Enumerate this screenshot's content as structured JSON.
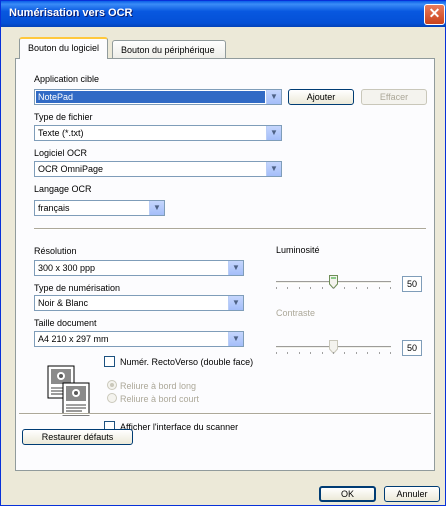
{
  "window": {
    "title": "Numérisation vers OCR",
    "close_glyph": "✕"
  },
  "tabs": [
    {
      "label": "Bouton du logiciel",
      "active": true
    },
    {
      "label": "Bouton du périphérique",
      "active": false
    }
  ],
  "application": {
    "label": "Application cible",
    "value": "NotePad",
    "add_button": "Ajouter",
    "delete_button": "Effacer"
  },
  "file_type": {
    "label": "Type de fichier",
    "value": "Texte (*.txt)"
  },
  "ocr_software": {
    "label": "Logiciel OCR",
    "value": "OCR OmniPage"
  },
  "ocr_language": {
    "label": "Langage OCR",
    "value": "français"
  },
  "resolution": {
    "label": "Résolution",
    "value": "300 x 300 ppp"
  },
  "scan_type": {
    "label": "Type de numérisation",
    "value": "Noir & Blanc"
  },
  "document_size": {
    "label": "Taille document",
    "value": "A4 210 x 297 mm"
  },
  "brightness": {
    "label": "Luminosité",
    "value": "50",
    "level": 0.5
  },
  "contrast": {
    "label": "Contraste",
    "value": "50",
    "level": 0.5,
    "enabled": false
  },
  "duplex": {
    "label": "Numér. RectoVerso (double face)",
    "checked": false,
    "options": [
      {
        "label": "Reliure à bord long",
        "selected": true
      },
      {
        "label": "Reliure à bord court",
        "selected": false
      }
    ]
  },
  "show_scanner_interface": {
    "label": "Afficher l'interface du scanner",
    "checked": false
  },
  "restore_defaults_button": "Restaurer défauts",
  "ok_button": "OK",
  "cancel_button": "Annuler",
  "icons": {
    "duplex_illustration": "duplex-pages-icon",
    "dropdown": "chevron-down-icon"
  }
}
